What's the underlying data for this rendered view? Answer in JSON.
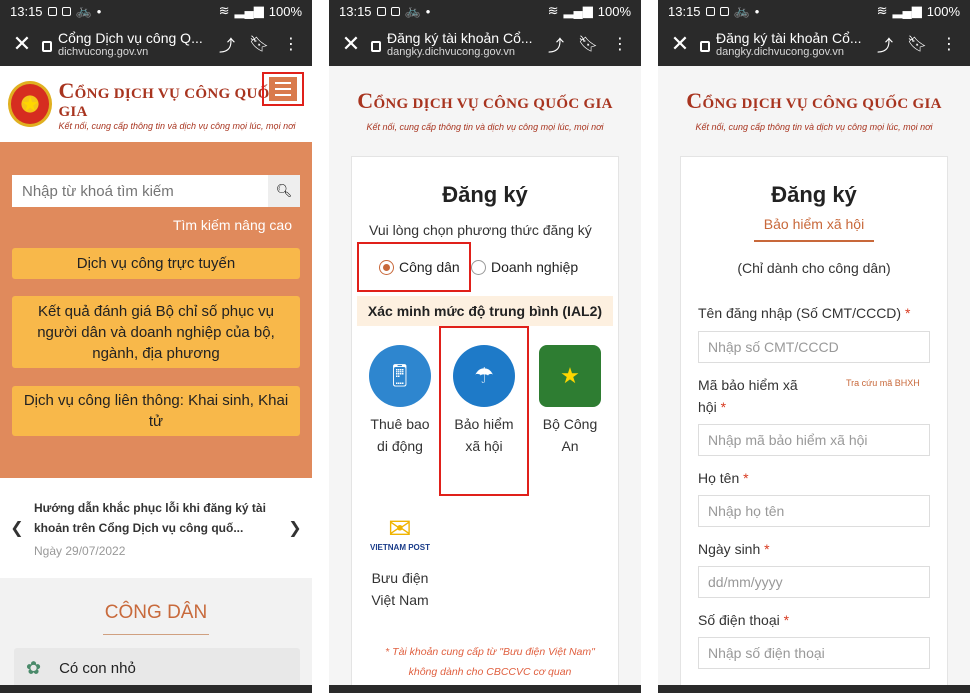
{
  "status": {
    "time": "13:15",
    "battery": "100%"
  },
  "screens": [
    {
      "tab_title": "Cổng Dịch vụ công Q...",
      "host": "dichvucong.gov.vn"
    },
    {
      "tab_title": "Đăng ký tài khoản Cổ...",
      "host": "dangky.dichvucong.gov.vn"
    },
    {
      "tab_title": "Đăng ký tài khoản Cổ...",
      "host": "dangky.dichvucong.gov.vn"
    }
  ],
  "brand": {
    "name": "CỔNG DỊCH VỤ CÔNG QUỐC GIA",
    "name_first": "C",
    "name_rest": "ỔNG DỊCH VỤ CÔNG QUỐC GIA",
    "tagline": "Kết nối, cung cấp thông tin và dịch vụ công mọi lúc, mọi nơi"
  },
  "home": {
    "search_placeholder": "Nhập từ khoá tìm kiếm",
    "advanced_search": "Tìm kiếm nâng cao",
    "buttons": [
      "Dịch vụ công trực tuyến",
      "Kết quả đánh giá Bộ chỉ số phục vụ người dân và doanh nghiệp của bộ, ngành, địa phương",
      "Dịch vụ công liên thông: Khai sinh, Khai tử"
    ],
    "news_title": "Hướng dẫn khắc phục lỗi khi đăng ký tài khoản trên Cổng Dịch vụ công quố...",
    "news_date": "Ngày 29/07/2022",
    "section_title": "CÔNG DÂN",
    "section_item": "Có con nhỏ"
  },
  "register": {
    "title": "Đăng ký",
    "choose_method": "Vui lòng chọn phương thức đăng ký",
    "radio_citizen": "Công dân",
    "radio_business": "Doanh nghiệp",
    "verify_level": "Xác minh mức độ trung bình (IAL2)",
    "opt_mobile": "Thuê bao di động",
    "opt_insurance": "Bảo hiểm xã hội",
    "opt_police": "Bộ Công An",
    "opt_post": "Bưu điện Việt Nam",
    "post_logo_text": "VIETNAM POST",
    "note": "* Tài khoản cung cấp từ \"Bưu điện Việt Nam\" không dành cho CBCCVC cơ quan"
  },
  "insurance_form": {
    "title": "Đăng ký",
    "tab": "Bảo hiểm xã hội",
    "citizen_only": "(Chỉ dành cho công dân)",
    "lookup_link": "Tra cứu mã BHXH",
    "fields": [
      {
        "label": "Tên đăng nhập (Số CMT/CCCD)",
        "placeholder": "Nhập số CMT/CCCD"
      },
      {
        "label": "Mã bảo hiểm xã hội",
        "placeholder": "Nhập mã bảo hiểm xã hội"
      },
      {
        "label": "Họ tên",
        "placeholder": "Nhập họ tên"
      },
      {
        "label": "Ngày sinh",
        "placeholder": "dd/mm/yyyy"
      },
      {
        "label": "Số điện thoại",
        "placeholder": "Nhập số điện thoại"
      }
    ],
    "required_mark": "*"
  },
  "icons": [
    "close-icon",
    "lock-icon",
    "share-icon",
    "bookmark-icon",
    "more-vert-icon",
    "menu-icon",
    "search-icon",
    "chevron-left-icon",
    "chevron-right-icon"
  ]
}
